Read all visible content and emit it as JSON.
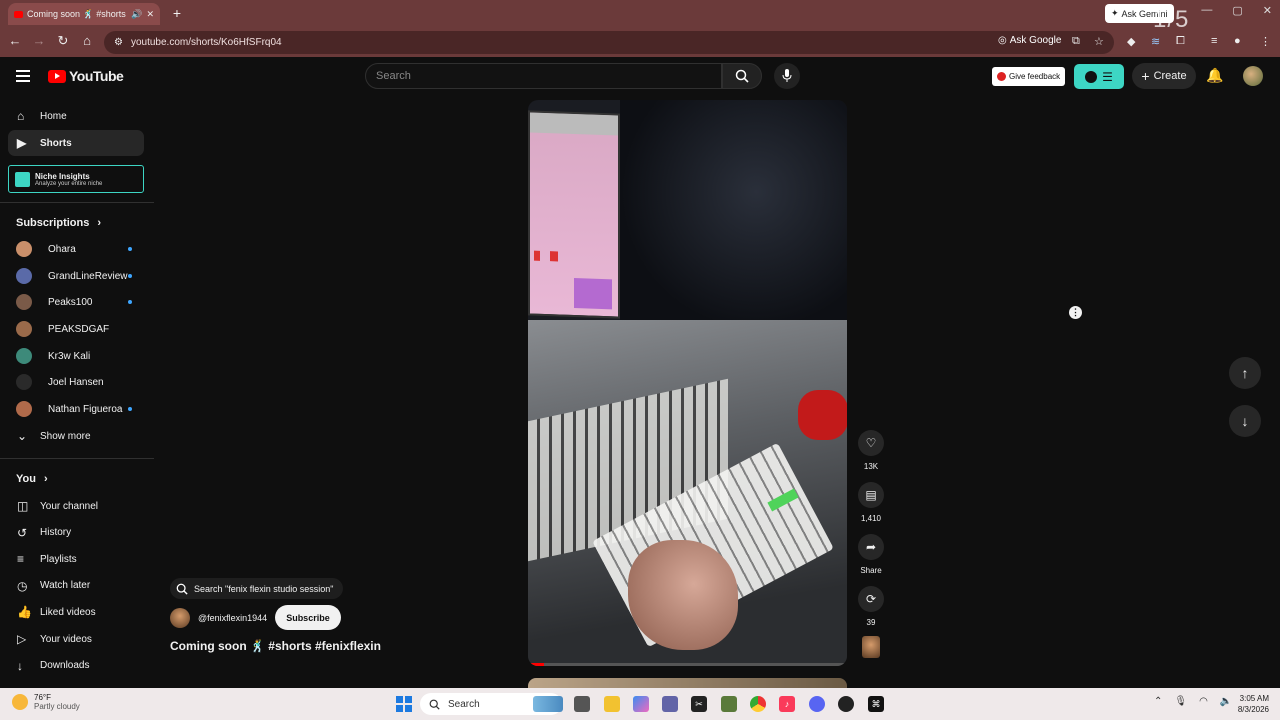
{
  "browser": {
    "tab_title": "Coming soon 🕺 #shorts #",
    "url": "youtube.com/shorts/Ko6HfSFrq04",
    "ask_google": "Ask Google",
    "ask_gemini": "Ask Gemini",
    "overlay_counter": "1/5"
  },
  "header": {
    "logo_text": "YouTube",
    "search_placeholder": "Search",
    "give_feedback": "Give feedback",
    "create_label": "Create"
  },
  "sidebar": {
    "main": [
      {
        "label": "Home",
        "icon": "home-icon"
      },
      {
        "label": "Shorts",
        "icon": "shorts-icon"
      }
    ],
    "niche": {
      "title": "Niche Insights",
      "subtitle": "Analyze your entire niche"
    },
    "subscriptions_heading": "Subscriptions",
    "subscriptions": [
      {
        "name": "Ohara",
        "color": "#c98f6a",
        "dot": true
      },
      {
        "name": "GrandLineReview",
        "color": "#5a6aa8",
        "dot": true
      },
      {
        "name": "Peaks100",
        "color": "#7a5a48",
        "dot": true
      },
      {
        "name": "PEAKSDGAF",
        "color": "#9a6a4a",
        "dot": false
      },
      {
        "name": "Kr3w Kali",
        "color": "#3d8a7a",
        "dot": false
      },
      {
        "name": "Joel Hansen",
        "color": "#2a2a2a",
        "dot": false
      },
      {
        "name": "Nathan Figueroa",
        "color": "#b06a4a",
        "dot": true
      }
    ],
    "show_more": "Show more",
    "you_heading": "You",
    "you_items": [
      {
        "label": "Your channel",
        "icon": "channel-icon"
      },
      {
        "label": "History",
        "icon": "history-icon"
      },
      {
        "label": "Playlists",
        "icon": "playlists-icon"
      },
      {
        "label": "Watch later",
        "icon": "clock-icon"
      },
      {
        "label": "Liked videos",
        "icon": "thumbs-up-icon"
      },
      {
        "label": "Your videos",
        "icon": "video-icon"
      },
      {
        "label": "Downloads",
        "icon": "download-icon"
      }
    ]
  },
  "player": {
    "search_chip": "Search \"fenix flexin studio session\"",
    "channel_handle": "@fenixflexin1944",
    "subscribe_label": "Subscribe",
    "title": "Coming soon 🕺 #shorts #fenixflexin",
    "progress_fraction": 0.05,
    "likes": "13K",
    "comments": "1,410",
    "share_label": "Share",
    "remix_count": "39"
  },
  "taskbar": {
    "temperature": "76°F",
    "weather": "Partly cloudy",
    "search_label": "Search",
    "time": "3:05 AM",
    "date": "8/3/2026"
  }
}
